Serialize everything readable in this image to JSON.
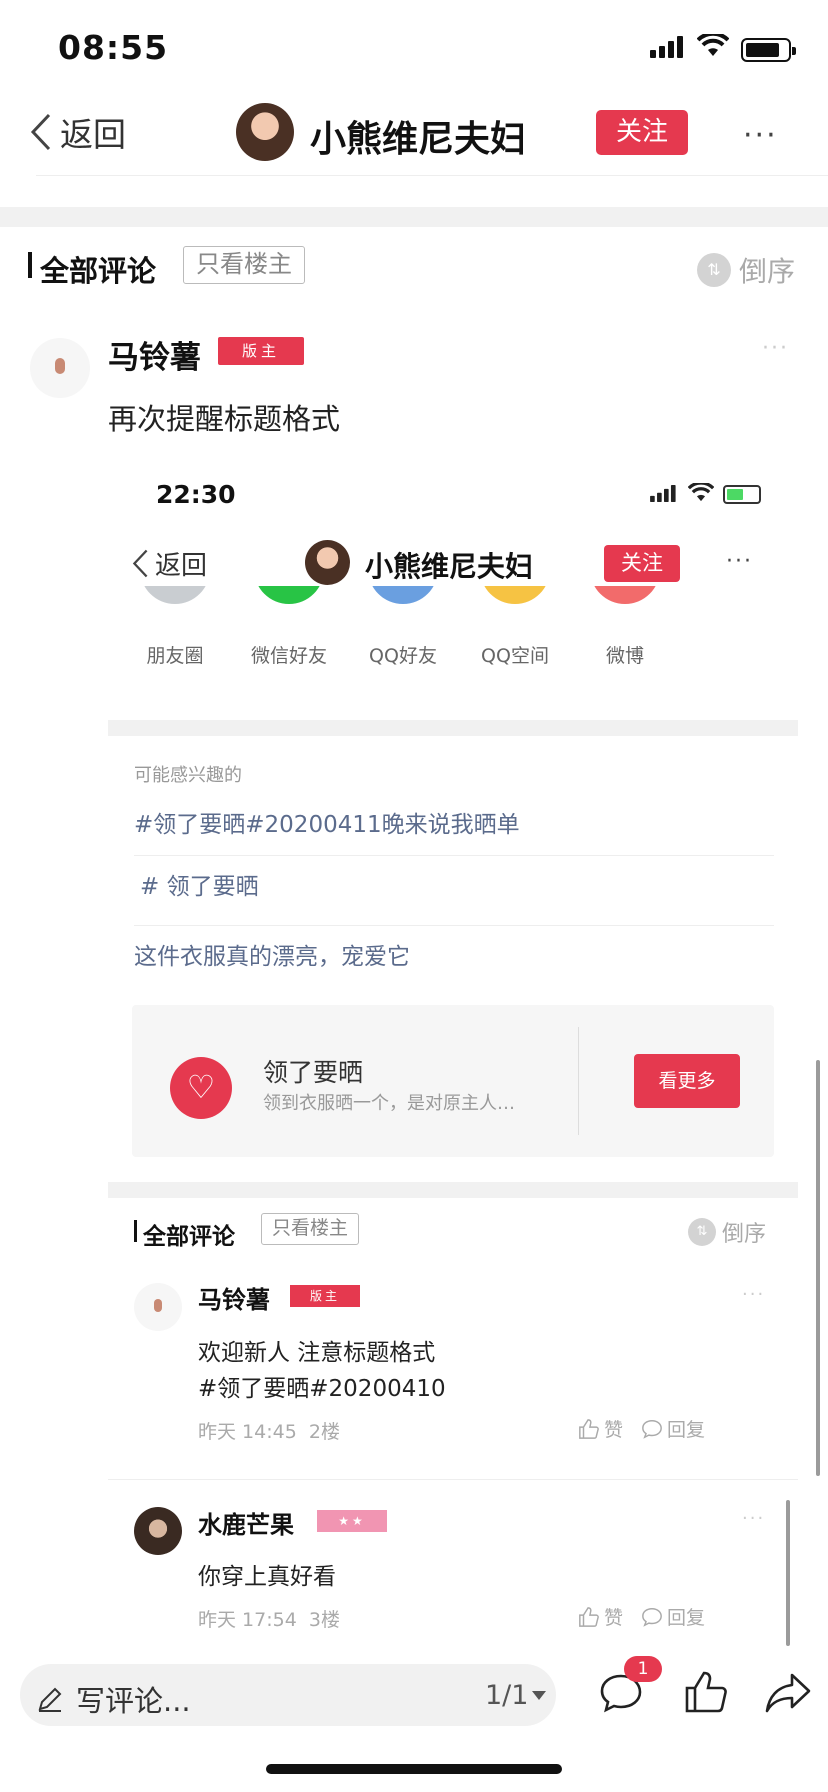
{
  "status_bar": {
    "time": "08:55"
  },
  "nav": {
    "back_label": "返回",
    "title": "小熊维尼夫妇",
    "follow_label": "关注",
    "more": "···"
  },
  "comments_header": {
    "title": "全部评论",
    "owner_only": "只看楼主",
    "sort_label": "倒序"
  },
  "comment": {
    "name": "马铃薯",
    "badge": "版主",
    "text": "再次提醒标题格式",
    "more": "···"
  },
  "embedded": {
    "time": "22:30",
    "back_label": "返回",
    "title": "小熊维尼夫妇",
    "follow_label": "关注",
    "more": "···",
    "share_targets": [
      {
        "label": "朋友圈",
        "color": "#c9cdd1"
      },
      {
        "label": "微信好友",
        "color": "#28c445"
      },
      {
        "label": "QQ好友",
        "color": "#6a9fe0"
      },
      {
        "label": "QQ空间",
        "color": "#f6c343"
      },
      {
        "label": "微博",
        "color": "#f26b6b"
      }
    ],
    "interest_label": "可能感兴趣的",
    "topics": [
      "#领了要晒#20200411晚来说我晒单",
      "# 领了要晒",
      "这件衣服真的漂亮，宠爱它"
    ],
    "card": {
      "title": "领了要晒",
      "subtitle": "领到衣服晒一个，是对原主人…",
      "button": "看更多",
      "icon": "heart-icon"
    },
    "comments_header": {
      "title": "全部评论",
      "owner_only": "只看楼主",
      "sort_label": "倒序"
    },
    "comments": [
      {
        "name": "马铃薯",
        "badge": "版主",
        "line1": "欢迎新人 注意标题格式",
        "line2": "#领了要晒#20200410",
        "time": "昨天 14:45",
        "floor": "2楼",
        "like": "赞",
        "reply": "回复"
      },
      {
        "name": "水鹿芒果",
        "badge": "★★",
        "line1": "你穿上真好看",
        "time": "昨天 17:54",
        "floor": "3楼",
        "like": "赞",
        "reply": "回复"
      }
    ]
  },
  "bottom": {
    "write_placeholder": "写评论...",
    "page": "1/1",
    "comment_count": "1"
  },
  "colors": {
    "accent": "#e5394f",
    "link": "#5b6b8c",
    "stars_badge": "#f195b2"
  }
}
